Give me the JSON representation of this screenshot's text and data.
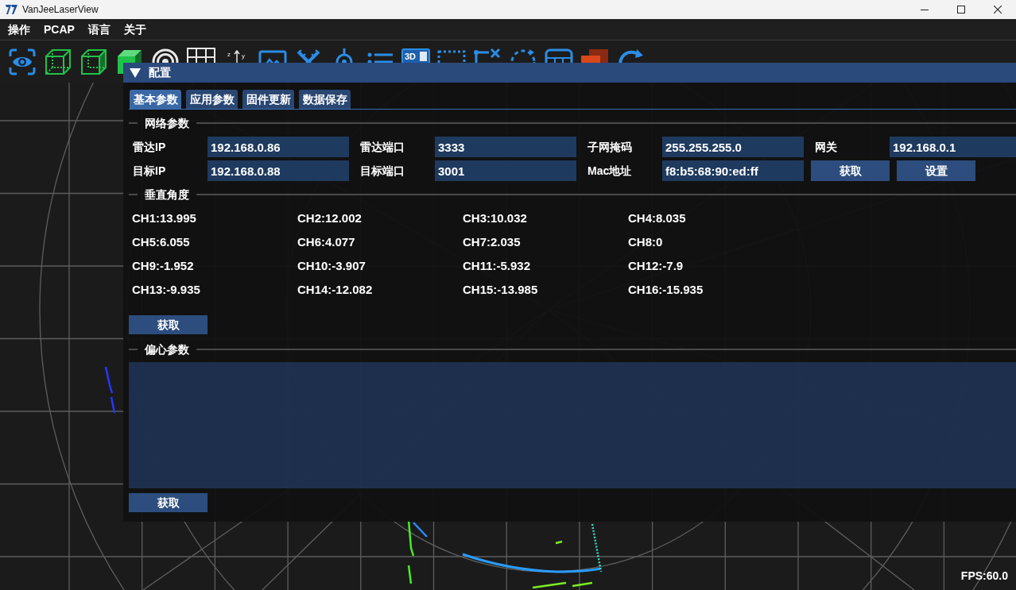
{
  "window": {
    "title": "VanJeeLaserView"
  },
  "menu": [
    {
      "label": "操作"
    },
    {
      "label": "PCAP"
    },
    {
      "label": "语言"
    },
    {
      "label": "关于"
    }
  ],
  "toolbar": [
    {
      "kind": "eye"
    },
    {
      "kind": "cube_wire"
    },
    {
      "kind": "cube_half"
    },
    {
      "kind": "cube_solid"
    },
    {
      "kind": "target"
    },
    {
      "kind": "grid"
    },
    {
      "kind": "axes",
      "labels": [
        "z",
        "y"
      ]
    },
    {
      "kind": "monitor"
    },
    {
      "kind": "ruler"
    },
    {
      "kind": "pin"
    },
    {
      "kind": "list"
    },
    {
      "kind": "view3d",
      "label": "3D"
    },
    {
      "kind": "dashed"
    },
    {
      "kind": "crosshair"
    },
    {
      "kind": "rotate"
    },
    {
      "kind": "table"
    },
    {
      "kind": "layers"
    },
    {
      "kind": "refresh"
    }
  ],
  "config_panel": {
    "title": "配置",
    "tabs": [
      {
        "label": "基本参数",
        "selected": true
      },
      {
        "label": "应用参数",
        "selected": false
      },
      {
        "label": "固件更新",
        "selected": false
      },
      {
        "label": "数据保存",
        "selected": false
      }
    ],
    "sections": [
      {
        "kind": "network",
        "title": "网络参数",
        "rows": [
          [
            {
              "label": "雷达IP",
              "value": "192.168.0.86"
            },
            {
              "label": "雷达端口",
              "value": "3333"
            },
            {
              "label": "子网掩码",
              "value": "255.255.255.0"
            },
            {
              "label": "网关",
              "value": "192.168.0.1"
            }
          ],
          [
            {
              "label": "目标IP",
              "value": "192.168.0.88"
            },
            {
              "label": "目标端口",
              "value": "3001"
            },
            {
              "label": "Mac地址",
              "value": "f8:b5:68:90:ed:ff"
            }
          ]
        ],
        "buttons": [
          "获取",
          "设置"
        ]
      },
      {
        "kind": "channels",
        "title": "垂直角度",
        "channels": [
          "CH1:13.995",
          "CH2:12.002",
          "CH3:10.032",
          "CH4:8.035",
          "CH5:6.055",
          "CH6:4.077",
          "CH7:2.035",
          "CH8:0",
          "CH9:-1.952",
          "CH10:-3.907",
          "CH11:-5.932",
          "CH12:-7.9",
          "CH13:-9.935",
          "CH14:-12.082",
          "CH15:-13.985",
          "CH16:-15.935"
        ],
        "buttons": [
          "获取"
        ]
      },
      {
        "kind": "text",
        "title": "偏心参数",
        "buttons": [
          "获取"
        ]
      }
    ]
  },
  "status": {
    "fps": "FPS:60.0"
  }
}
